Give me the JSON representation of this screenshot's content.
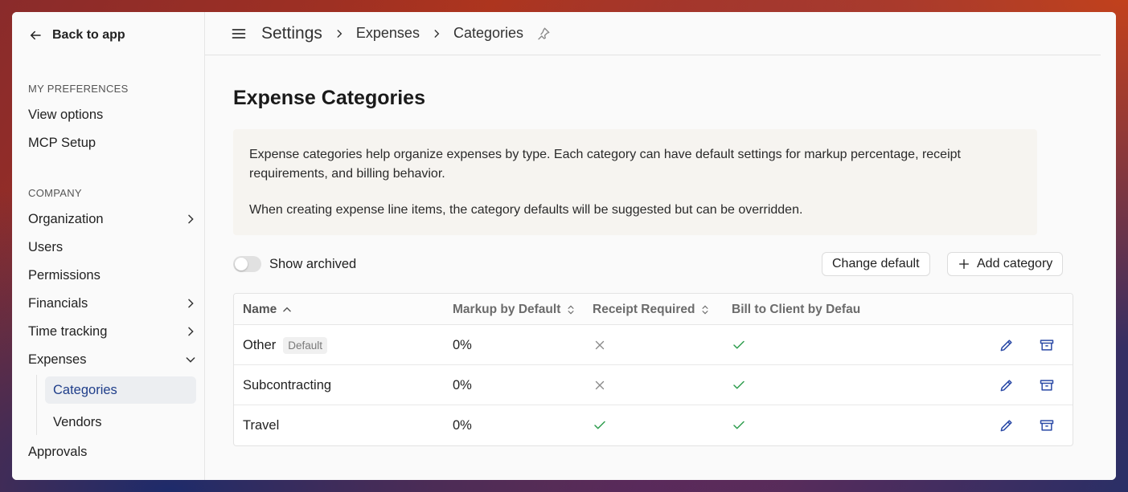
{
  "sidebar": {
    "back_label": "Back to app",
    "sections": {
      "preferences_title": "MY PREFERENCES",
      "company_title": "COMPANY"
    },
    "preferences": [
      "View options",
      "MCP Setup"
    ],
    "company": [
      "Organization",
      "Users",
      "Permissions",
      "Financials",
      "Time tracking",
      "Expenses",
      "Approvals"
    ],
    "expenses_sub": [
      "Categories",
      "Vendors"
    ]
  },
  "breadcrumb": {
    "root": "Settings",
    "level1": "Expenses",
    "level2": "Categories"
  },
  "page": {
    "title": "Expense Categories",
    "info_p1": "Expense categories help organize expenses by type. Each category can have default settings for markup percentage, receipt requirements, and billing behavior.",
    "info_p2": "When creating expense line items, the category defaults will be suggested but can be overridden.",
    "toggle_label": "Show archived",
    "change_default_label": "Change default",
    "add_category_label": "Add category"
  },
  "table": {
    "columns": [
      "Name",
      "Markup by Default",
      "Receipt Required",
      "Bill to Client by Defau"
    ],
    "default_badge": "Default",
    "rows": [
      {
        "name": "Other",
        "markup": "0%",
        "receipt": false,
        "bill": true
      },
      {
        "name": "Subcontracting",
        "markup": "0%",
        "receipt": false,
        "bill": true
      },
      {
        "name": "Travel",
        "markup": "0%",
        "receipt": true,
        "bill": true
      }
    ]
  },
  "colors": {
    "check": "#2e9d4e",
    "cross": "#8a8a8a",
    "action": "#2b4aa6",
    "active_nav": "#1f3e8a"
  },
  "icons": [
    "arrow-left-icon",
    "chevron-right-icon",
    "chevron-down-icon",
    "menu-icon",
    "pin-icon",
    "plus-icon",
    "sort-asc-icon",
    "sort-icon",
    "check-icon",
    "x-icon",
    "pencil-icon",
    "archive-icon"
  ]
}
